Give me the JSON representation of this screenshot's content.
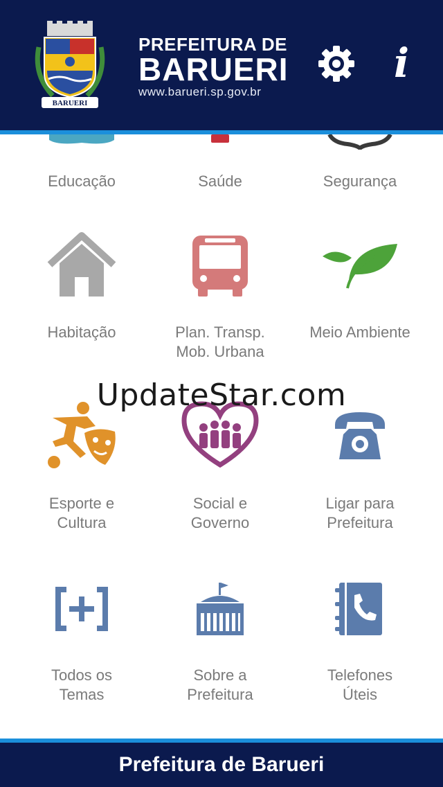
{
  "header": {
    "title_line1": "PREFEITURA DE",
    "title_line2": "BARUERI",
    "url": "www.barueri.sp.gov.br",
    "crest_text": "BARUERI",
    "settings_icon": "gear-icon",
    "info_icon": "info-icon",
    "info_glyph": "i"
  },
  "menu": {
    "row0": [
      {
        "label": "Educação",
        "icon": "education-icon"
      },
      {
        "label": "Saúde",
        "icon": "health-icon"
      },
      {
        "label": "Segurança",
        "icon": "security-icon"
      }
    ],
    "row1": [
      {
        "line1": "Habitação",
        "line2": "",
        "icon": "house-icon"
      },
      {
        "line1": "Plan. Transp.",
        "line2": "Mob. Urbana",
        "icon": "bus-icon"
      },
      {
        "line1": "Meio Ambiente",
        "line2": "",
        "icon": "leaf-icon"
      }
    ],
    "row2": [
      {
        "line1": "Esporte e",
        "line2": "Cultura",
        "icon": "sport-culture-icon"
      },
      {
        "line1": "Social e",
        "line2": "Governo",
        "icon": "family-heart-icon"
      },
      {
        "line1": "Ligar para",
        "line2": "Prefeitura",
        "icon": "telephone-icon"
      }
    ],
    "row3": [
      {
        "line1": "Todos os",
        "line2": "Temas",
        "icon": "plus-bracket-icon"
      },
      {
        "line1": "Sobre a",
        "line2": "Prefeitura",
        "icon": "building-icon"
      },
      {
        "line1": "Telefones",
        "line2": "Úteis",
        "icon": "phonebook-icon"
      }
    ]
  },
  "watermark": "UpdateStar.com",
  "footer": {
    "title": "Prefeitura de Barueri"
  },
  "colors": {
    "header_bg": "#0b1a4e",
    "accent_stripe": "#1b8fdb",
    "label_gray": "#7a7a7a",
    "house_gray": "#a8a8a8",
    "bus_red": "#d47a7a",
    "leaf_green": "#4da33a",
    "sport_orange": "#e0922a",
    "social_purple": "#93407f",
    "icon_blue": "#5b7cac"
  }
}
